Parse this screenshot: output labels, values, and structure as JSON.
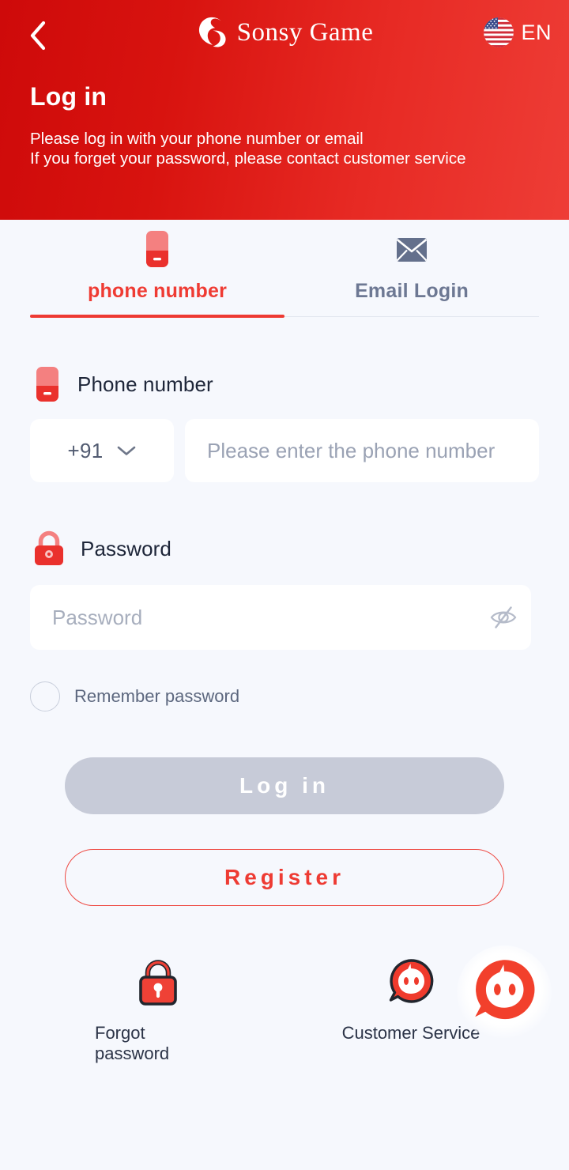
{
  "header": {
    "back_icon": "chevron-left-icon",
    "brand_mark_icon": "sonsy-s-logo-icon",
    "brand_name": "Sonsy Game",
    "flag_icon": "us-flag-icon",
    "language": "EN",
    "title": "Log in",
    "subtitle_line1": "Please log in with your phone number or email",
    "subtitle_line2": "If you forget your password, please contact customer service",
    "gradient_from": "#ce0a0a",
    "gradient_to": "#ee3d36"
  },
  "tabs": [
    {
      "label": "phone number",
      "icon": "phone-icon",
      "active": true
    },
    {
      "label": "Email Login",
      "icon": "envelope-icon",
      "active": false
    }
  ],
  "form": {
    "phone": {
      "label": "Phone number",
      "label_icon": "phone-icon",
      "country_code": "+91",
      "chevron_icon": "chevron-down-icon",
      "placeholder": "Please enter the phone number",
      "value": ""
    },
    "password": {
      "label": "Password",
      "label_icon": "lock-icon",
      "placeholder": "Password",
      "value": "",
      "toggle_icon": "eye-off-icon"
    },
    "remember": {
      "label": "Remember password",
      "checked": false
    }
  },
  "actions": {
    "login_label": "Log in",
    "login_enabled": false,
    "register_label": "Register"
  },
  "footer": [
    {
      "label": "Forgot password",
      "icon": "lock-keyhole-icon"
    },
    {
      "label": "Customer Service",
      "icon": "chat-face-icon"
    }
  ],
  "floating": {
    "icon": "chat-face-icon",
    "label": ""
  },
  "colors": {
    "accent_red": "#ee3b33",
    "deep_red": "#ce0a0a",
    "page_bg": "#f6f8fd",
    "card_bg": "#ffffff",
    "muted_text": "#6d7893",
    "dark_text": "#1e2639",
    "disabled_btn": "#c7cbd8"
  }
}
